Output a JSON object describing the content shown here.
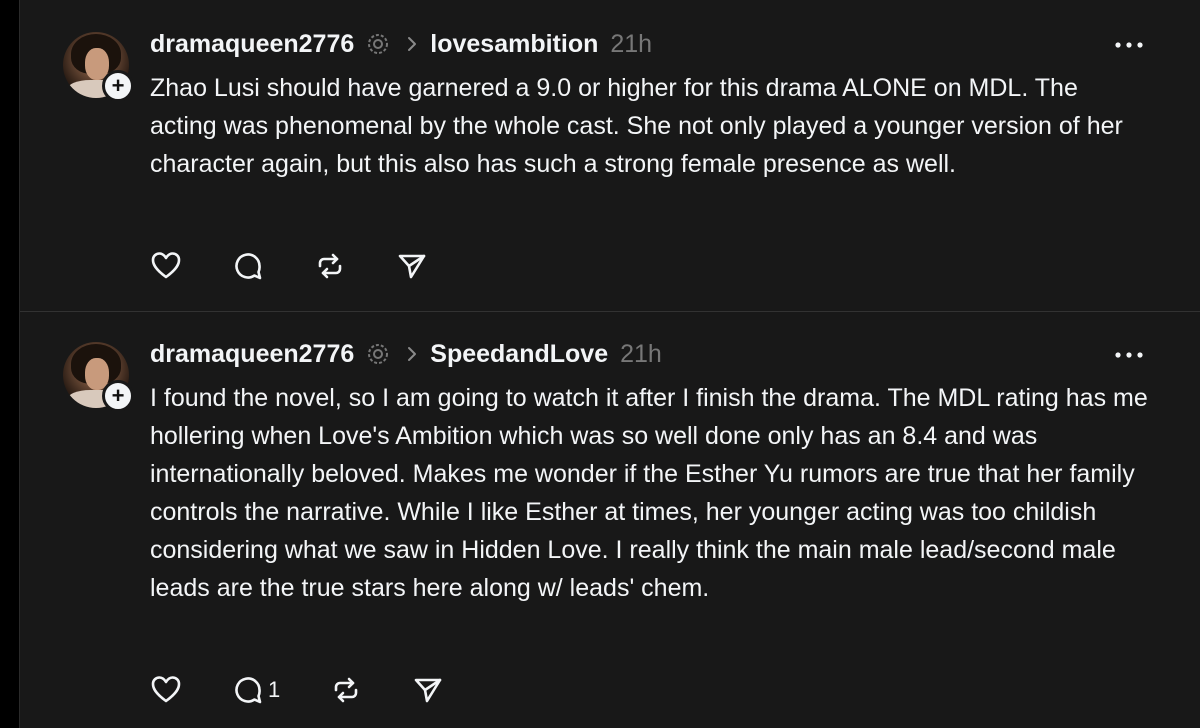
{
  "posts": [
    {
      "username": "dramaqueen2776",
      "topic": "lovesambition",
      "time": "21h",
      "text": "Zhao Lusi should have garnered a 9.0 or higher for this drama ALONE on MDL. The acting was phenomenal by the whole cast. She not only played a younger version of her character again, but this also has such a strong female presence as well.",
      "reply_count": ""
    },
    {
      "username": "dramaqueen2776",
      "topic": "SpeedandLove",
      "time": "21h",
      "text": "I found the novel, so I am going to watch it after I finish the drama. The MDL rating has me hollering when Love's Ambition which was so well done only has an 8.4 and was internationally beloved. Makes me wonder if the Esther Yu rumors are true that her family controls the narrative. While I like Esther at times, her younger acting was too childish considering what we saw in Hidden Love. I really think the main male lead/second male leads are the true stars here along w/ leads' chem.",
      "reply_count": "1"
    }
  ],
  "icons": {
    "follow": "+",
    "verified": "verified-icon",
    "chevron": "chevron-right-icon",
    "more": "more-icon",
    "like": "heart-icon",
    "reply": "comment-icon",
    "repost": "repost-icon",
    "share": "send-icon"
  },
  "colors": {
    "background": "#181818",
    "text": "#f3f5f7",
    "muted": "#777777",
    "divider": "#323232"
  }
}
